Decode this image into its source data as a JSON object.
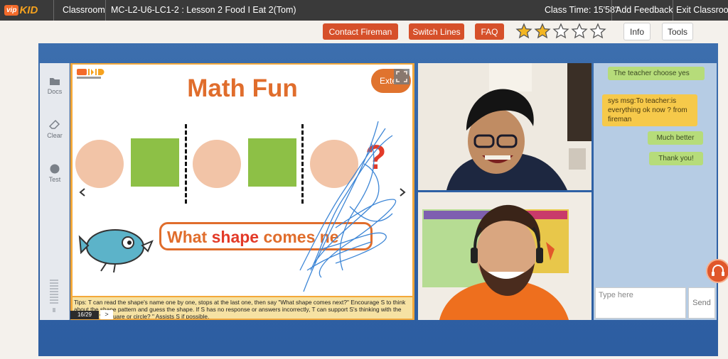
{
  "topbar": {
    "logo_vip": "vip",
    "logo_kid": "KID",
    "classroom": "Classroom",
    "lesson": "MC-L2-U6-LC1-2 : Lesson 2 Food I Eat 2(Tom)",
    "class_time": "Class Time: 15'58\"",
    "add_feedback": "Add Feedback",
    "exit": "Exit Classroom"
  },
  "actions": {
    "contact": "Contact Fireman",
    "switch": "Switch Lines",
    "faq": "FAQ",
    "info": "Info",
    "tools": "Tools",
    "rating": 2,
    "max_rating": 5,
    "star_color": "#f3b623"
  },
  "tools": [
    {
      "label": "Docs",
      "icon": "folder-icon"
    },
    {
      "label": "Clear",
      "icon": "eraser-icon"
    },
    {
      "label": "Test",
      "icon": "test-icon"
    }
  ],
  "slide": {
    "title": "Math Fun",
    "ext_label": "Exte",
    "bubble_pre": "What ",
    "bubble_hl": "shape",
    "bubble_post": " comes ne",
    "question": "?",
    "tips": "Tips: T can read the shape's name one by one,  stops at the last one, then say \"What shape comes next?\" Encourage S to think about the shape pattern and guess the shape. If S has no response or answers incorrectly, T can support S's thinking with the question: \"A square or circle? \" Assists S if possible.",
    "page": "16/29",
    "next": ">",
    "colors": {
      "accent": "#e06d2c",
      "circle": "#f2c4a7",
      "square": "#8dc046",
      "question": "#e33a28"
    }
  },
  "chat": {
    "messages": [
      {
        "text": "The teacher choose yes",
        "type": "green"
      },
      {
        "text": "sys msg:To teacher:is everything ok now ? from fireman",
        "type": "yellow"
      },
      {
        "text": "Much better",
        "type": "green"
      },
      {
        "text": "Thank you!",
        "type": "green"
      }
    ],
    "placeholder": "Type here",
    "send": "Send"
  }
}
